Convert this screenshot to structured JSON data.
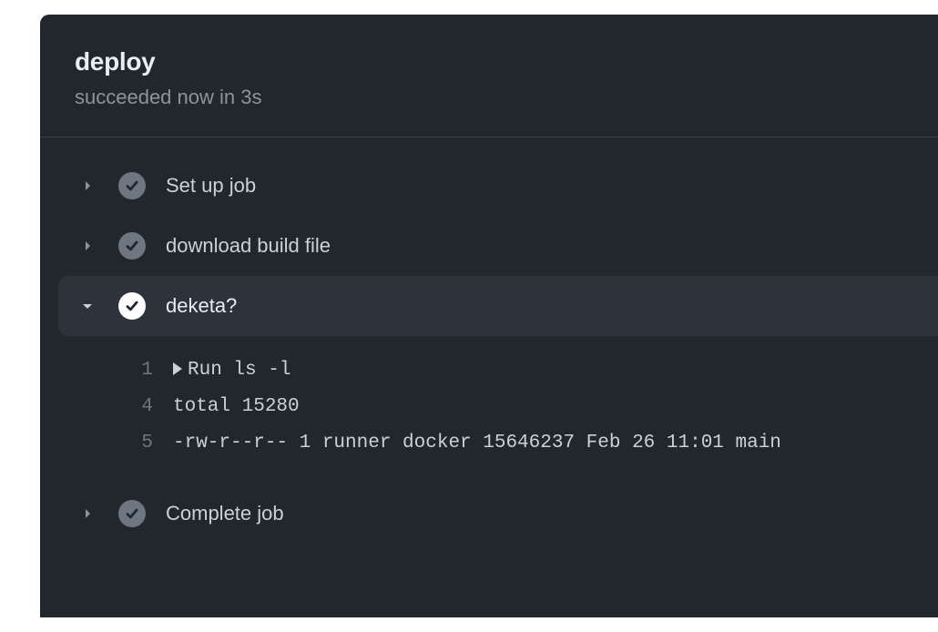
{
  "header": {
    "title": "deploy",
    "subtitle": "succeeded now in 3s"
  },
  "steps": [
    {
      "label": "Set up job",
      "expanded": false,
      "status": "muted"
    },
    {
      "label": "download build file",
      "expanded": false,
      "status": "muted"
    },
    {
      "label": "deketa?",
      "expanded": true,
      "status": "active"
    },
    {
      "label": "Complete job",
      "expanded": false,
      "status": "muted"
    }
  ],
  "log": {
    "lines": [
      {
        "num": "1",
        "text": "Run ls -l",
        "toggle": true
      },
      {
        "num": "4",
        "text": "total 15280",
        "toggle": false
      },
      {
        "num": "5",
        "text": "-rw-r--r-- 1 runner docker 15646237 Feb 26 11:01 main",
        "toggle": false
      }
    ]
  }
}
